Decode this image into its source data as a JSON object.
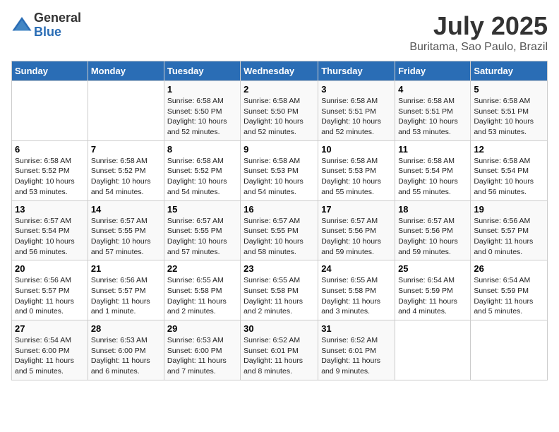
{
  "logo": {
    "general": "General",
    "blue": "Blue"
  },
  "title": "July 2025",
  "subtitle": "Buritama, Sao Paulo, Brazil",
  "headers": [
    "Sunday",
    "Monday",
    "Tuesday",
    "Wednesday",
    "Thursday",
    "Friday",
    "Saturday"
  ],
  "weeks": [
    [
      {
        "day": "",
        "info": ""
      },
      {
        "day": "",
        "info": ""
      },
      {
        "day": "1",
        "info": "Sunrise: 6:58 AM\nSunset: 5:50 PM\nDaylight: 10 hours and 52 minutes."
      },
      {
        "day": "2",
        "info": "Sunrise: 6:58 AM\nSunset: 5:50 PM\nDaylight: 10 hours and 52 minutes."
      },
      {
        "day": "3",
        "info": "Sunrise: 6:58 AM\nSunset: 5:51 PM\nDaylight: 10 hours and 52 minutes."
      },
      {
        "day": "4",
        "info": "Sunrise: 6:58 AM\nSunset: 5:51 PM\nDaylight: 10 hours and 53 minutes."
      },
      {
        "day": "5",
        "info": "Sunrise: 6:58 AM\nSunset: 5:51 PM\nDaylight: 10 hours and 53 minutes."
      }
    ],
    [
      {
        "day": "6",
        "info": "Sunrise: 6:58 AM\nSunset: 5:52 PM\nDaylight: 10 hours and 53 minutes."
      },
      {
        "day": "7",
        "info": "Sunrise: 6:58 AM\nSunset: 5:52 PM\nDaylight: 10 hours and 54 minutes."
      },
      {
        "day": "8",
        "info": "Sunrise: 6:58 AM\nSunset: 5:52 PM\nDaylight: 10 hours and 54 minutes."
      },
      {
        "day": "9",
        "info": "Sunrise: 6:58 AM\nSunset: 5:53 PM\nDaylight: 10 hours and 54 minutes."
      },
      {
        "day": "10",
        "info": "Sunrise: 6:58 AM\nSunset: 5:53 PM\nDaylight: 10 hours and 55 minutes."
      },
      {
        "day": "11",
        "info": "Sunrise: 6:58 AM\nSunset: 5:54 PM\nDaylight: 10 hours and 55 minutes."
      },
      {
        "day": "12",
        "info": "Sunrise: 6:58 AM\nSunset: 5:54 PM\nDaylight: 10 hours and 56 minutes."
      }
    ],
    [
      {
        "day": "13",
        "info": "Sunrise: 6:57 AM\nSunset: 5:54 PM\nDaylight: 10 hours and 56 minutes."
      },
      {
        "day": "14",
        "info": "Sunrise: 6:57 AM\nSunset: 5:55 PM\nDaylight: 10 hours and 57 minutes."
      },
      {
        "day": "15",
        "info": "Sunrise: 6:57 AM\nSunset: 5:55 PM\nDaylight: 10 hours and 57 minutes."
      },
      {
        "day": "16",
        "info": "Sunrise: 6:57 AM\nSunset: 5:55 PM\nDaylight: 10 hours and 58 minutes."
      },
      {
        "day": "17",
        "info": "Sunrise: 6:57 AM\nSunset: 5:56 PM\nDaylight: 10 hours and 59 minutes."
      },
      {
        "day": "18",
        "info": "Sunrise: 6:57 AM\nSunset: 5:56 PM\nDaylight: 10 hours and 59 minutes."
      },
      {
        "day": "19",
        "info": "Sunrise: 6:56 AM\nSunset: 5:57 PM\nDaylight: 11 hours and 0 minutes."
      }
    ],
    [
      {
        "day": "20",
        "info": "Sunrise: 6:56 AM\nSunset: 5:57 PM\nDaylight: 11 hours and 0 minutes."
      },
      {
        "day": "21",
        "info": "Sunrise: 6:56 AM\nSunset: 5:57 PM\nDaylight: 11 hours and 1 minute."
      },
      {
        "day": "22",
        "info": "Sunrise: 6:55 AM\nSunset: 5:58 PM\nDaylight: 11 hours and 2 minutes."
      },
      {
        "day": "23",
        "info": "Sunrise: 6:55 AM\nSunset: 5:58 PM\nDaylight: 11 hours and 2 minutes."
      },
      {
        "day": "24",
        "info": "Sunrise: 6:55 AM\nSunset: 5:58 PM\nDaylight: 11 hours and 3 minutes."
      },
      {
        "day": "25",
        "info": "Sunrise: 6:54 AM\nSunset: 5:59 PM\nDaylight: 11 hours and 4 minutes."
      },
      {
        "day": "26",
        "info": "Sunrise: 6:54 AM\nSunset: 5:59 PM\nDaylight: 11 hours and 5 minutes."
      }
    ],
    [
      {
        "day": "27",
        "info": "Sunrise: 6:54 AM\nSunset: 6:00 PM\nDaylight: 11 hours and 5 minutes."
      },
      {
        "day": "28",
        "info": "Sunrise: 6:53 AM\nSunset: 6:00 PM\nDaylight: 11 hours and 6 minutes."
      },
      {
        "day": "29",
        "info": "Sunrise: 6:53 AM\nSunset: 6:00 PM\nDaylight: 11 hours and 7 minutes."
      },
      {
        "day": "30",
        "info": "Sunrise: 6:52 AM\nSunset: 6:01 PM\nDaylight: 11 hours and 8 minutes."
      },
      {
        "day": "31",
        "info": "Sunrise: 6:52 AM\nSunset: 6:01 PM\nDaylight: 11 hours and 9 minutes."
      },
      {
        "day": "",
        "info": ""
      },
      {
        "day": "",
        "info": ""
      }
    ]
  ]
}
